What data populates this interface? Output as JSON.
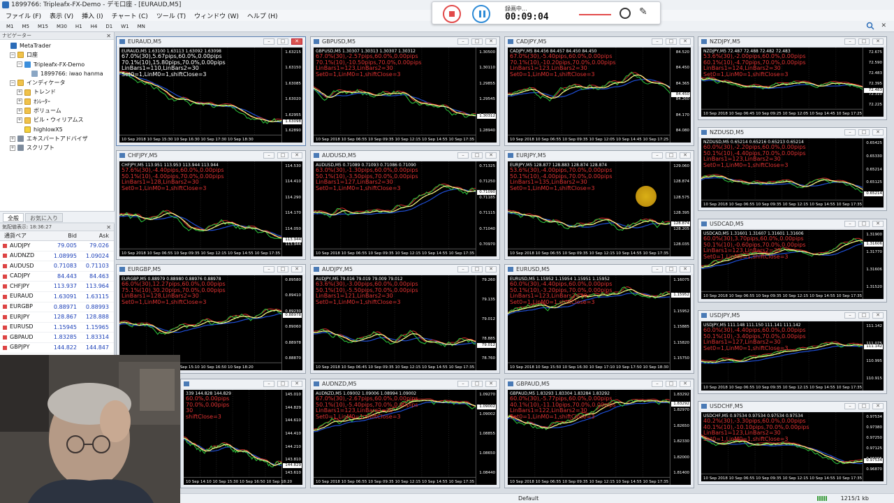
{
  "window": {
    "title": "1899766: Tripleafx-FX-Demo - デモ口座 - [EURAUD,M5]"
  },
  "menu": [
    "ファイル (F)",
    "表示 (V)",
    "挿入 (I)",
    "チャート (C)",
    "ツール (T)",
    "ウィンドウ (W)",
    "ヘルプ (H)"
  ],
  "timeframes": [
    "M1",
    "M5",
    "M15",
    "M30",
    "H1",
    "H4",
    "D1",
    "W1",
    "MN"
  ],
  "recorder": {
    "label": "録画中...",
    "time": "00:09:04"
  },
  "navigator": {
    "header": "ナビゲーター",
    "tree": [
      {
        "label": "MetaTrader",
        "indent": 0,
        "icon": "mt",
        "exp": ""
      },
      {
        "label": "口座",
        "indent": 1,
        "icon": "folder",
        "exp": "−"
      },
      {
        "label": "Tripleafx-FX-Demo",
        "indent": 2,
        "icon": "acct",
        "exp": "−"
      },
      {
        "label": "1899766: iwao hanma",
        "indent": 3,
        "icon": "user",
        "exp": ""
      },
      {
        "label": "インディケータ",
        "indent": 1,
        "icon": "folder",
        "exp": "−"
      },
      {
        "label": "トレンド",
        "indent": 2,
        "icon": "folder",
        "exp": "+"
      },
      {
        "label": "ｵｼﾚｰﾀｰ",
        "indent": 2,
        "icon": "folder",
        "exp": "+"
      },
      {
        "label": "ボリューム",
        "indent": 2,
        "icon": "folder",
        "exp": "+"
      },
      {
        "label": "ビル・ウィリアムス",
        "indent": 2,
        "icon": "folder",
        "exp": "+"
      },
      {
        "label": "highlowX5",
        "indent": 2,
        "icon": "ind",
        "exp": ""
      },
      {
        "label": "エキスパートアドバイザ",
        "indent": 1,
        "icon": "ea",
        "exp": "+"
      },
      {
        "label": "スクリプト",
        "indent": 1,
        "icon": "ea",
        "exp": "+"
      }
    ],
    "tabs": [
      "全般",
      "お気に入り"
    ]
  },
  "market_watch": {
    "header": "気配値表示: 18:36:27",
    "columns": [
      "通貨ペア",
      "Bid",
      "Ask"
    ],
    "rows": [
      {
        "symbol": "AUDJPY",
        "bid": "79.005",
        "ask": "79.026"
      },
      {
        "symbol": "AUDNZD",
        "bid": "1.08995",
        "ask": "1.09024"
      },
      {
        "symbol": "AUDUSD",
        "bid": "0.71083",
        "ask": "0.71103"
      },
      {
        "symbol": "CADJPY",
        "bid": "84.443",
        "ask": "84.463"
      },
      {
        "symbol": "CHFJPY",
        "bid": "113.937",
        "ask": "113.964"
      },
      {
        "symbol": "EURAUD",
        "bid": "1.63091",
        "ask": "1.63115"
      },
      {
        "symbol": "EURGBP",
        "bid": "0.88971",
        "ask": "0.88993"
      },
      {
        "symbol": "EURJPY",
        "bid": "128.867",
        "ask": "128.888"
      },
      {
        "symbol": "EURUSD",
        "bid": "1.15945",
        "ask": "1.15965"
      },
      {
        "symbol": "GBPAUD",
        "bid": "1.83285",
        "ask": "1.83314"
      },
      {
        "symbol": "GBPJPY",
        "bid": "144.822",
        "ask": "144.847"
      }
    ]
  },
  "charts": [
    {
      "title": "EURAUD,M5",
      "hdr": "EURAUD,M5 1.63100 1.63113 1.63092 1.63098",
      "ann": "67.0%(30),5.67pips,60.0%,0.00pips\n70.1%(10),15.80pips,70.0%,0.00pips\nLinBars1=110,LinBars2=30\nSet0=1,LinM0=1,shiftClose=3",
      "ann_color": "white",
      "xaxis": "10 Sep 2018    10 Sep 15:30    10 Sep 16:30    10 Sep 17:30    10 Sep 18:30",
      "yticks": [
        "1.63215",
        "1.63150",
        "1.63085",
        "1.63020",
        "1.62955",
        "1.62890"
      ],
      "tag": "1.63098",
      "active": true
    },
    {
      "title": "GBPUSD,M5",
      "hdr": "GBPUSD,M5 1.30307 1.30313 1.30307 1.30312",
      "ann": "67.0%(30),-2.57pips,60.0%,0.00pips\n70.1%(10),-10.50pips,70.0%,0.00pips\nLinBars1=123,LinBars2=30\nSet0=1,LinM0=1,shiftClose=3",
      "ann_color": "red",
      "xaxis": "10 Sep 2018    10 Sep 06:55    10 Sep 09:35    10 Sep 12:15    10 Sep 14:55    10 Sep 17:35",
      "yticks": [
        "1.30500",
        "1.30110",
        "1.29855",
        "1.29545",
        "1.29235",
        "1.28940"
      ],
      "tag": "1.30312",
      "active": false
    },
    {
      "title": "CADJPY,M5",
      "hdr": "CADJPY,M5 84.456 84.457 84.450 84.450",
      "ann": "67.0%(30),-5.40pips,60.0%,0.00pips\n70.1%(10),-10.20pips,70.0%,0.00pips\nLinBars1=123,LinBars2=30\nSet0=1,LinM0=1,shiftClose=3",
      "ann_color": "red",
      "xaxis": "10 Sep 2018    10 Sep 06:55    10 Sep 09:35    10 Sep 12:05    10 Sep 14:45    10 Sep 17:25",
      "yticks": [
        "84.520",
        "84.450",
        "84.365",
        "84.260",
        "84.170",
        "84.080"
      ],
      "tag": "84.450",
      "active": false
    },
    {
      "title": "NZDJPY,M5",
      "hdr": "NZDJPY,M5 72.487 72.488 72.482 72.483",
      "ann": "53.6%(30),-2.00pips,60.0%,0.00pips\n60.1%(10),-4.70pips,70.0%,0.00pips\nLinBars1=124,LinBars2=30\nSet0=1,LinM0=1,shiftClose=3",
      "ann_color": "red",
      "xaxis": "10 Sep 2018    10 Sep 06:45    10 Sep 09:25    10 Sep 12:05    10 Sep 14:45    10 Sep 17:25",
      "yticks": [
        "72.675",
        "72.590",
        "72.483",
        "72.395",
        "72.310",
        "72.225"
      ],
      "tag": "72.483",
      "active": false
    },
    {
      "title": "CHFJPY,M5",
      "hdr": "CHFJPY,M5 113.951 113.953 113.944 113.944",
      "ann": "57.6%(30),-4.40pips,60.0%,0.00pips\n50.1%(10),-4.00pips,70.0%,0.00pips\nLinBars1=128,LinBars2=30\nSet0=1,LinM0=1,shiftClose=3",
      "ann_color": "red",
      "xaxis": "10 Sep 2018    10 Sep 06:55    10 Sep 09:35    10 Sep 12:15    10 Sep 14:55    10 Sep 17:35",
      "yticks": [
        "114.530",
        "114.410",
        "114.290",
        "114.170",
        "114.050",
        "113.944"
      ],
      "tag": "113.944",
      "active": false
    },
    {
      "title": "AUDUSD,M5",
      "hdr": "AUDUSD,M5 0.71089 0.71093 0.71086 0.71090",
      "ann": "63.0%(30),-1.30pips,60.0%,0.00pips\n50.1%(10),-3.50pips,70.0%,0.00pips\nLinBars1=127,LinBars2=30\nSet0=1,LinM0=1,shiftClose=3",
      "ann_color": "red",
      "xaxis": "10 Sep 2018    10 Sep 06:55    10 Sep 09:35    10 Sep 12:15    10 Sep 14:55    10 Sep 17:35",
      "yticks": [
        "0.71325",
        "0.71250",
        "0.71185",
        "0.71115",
        "0.71040",
        "0.70970"
      ],
      "tag": "0.71090",
      "active": false
    },
    {
      "title": "EURJPY,M5",
      "hdr": "EURJPY,M5 128.877 128.883 128.874 128.874",
      "ann": "53.6%(30),-4.00pips,70.0%,0.00pips\n50.1%(10),-4.00pips,70.0%,0.00pips\nLinBars1=135,LinBars2=30\nSet0=1,LinM0=1,shiftClose=3",
      "ann_color": "red",
      "xaxis": "10 Sep 2018    10 Sep 06:55    10 Sep 09:35    10 Sep 12:15    10 Sep 14:55    10 Sep 17:35",
      "yticks": [
        "129.060",
        "128.874",
        "128.575",
        "128.395",
        "128.205",
        "128.035"
      ],
      "tag": "128.874",
      "active": false
    },
    {
      "title": "NZDUSD,M5",
      "hdr": "NZDUSD,M5 0.65214 0.65216 0.65213 0.65214",
      "ann": "60.0%(30),-2.20pips,60.0%,0.00pips\n50.1%(10),-4.40pips,70.0%,0.00pips\nLinBars1=123,LinBars2=30\nSet0=1,LinM0=1,shiftClose=3",
      "ann_color": "red",
      "xaxis": "10 Sep 2018    10 Sep 06:55    10 Sep 09:35    10 Sep 12:15    10 Sep 14:55    10 Sep 17:35",
      "yticks": [
        "0.65425",
        "0.65330",
        "0.65214",
        "0.65125",
        "0.65040"
      ],
      "tag": "0.65214",
      "active": false
    },
    {
      "title": "EURGBP,M5",
      "hdr": "EURGBP,M5 0.88979 0.88980 0.88976 0.88978",
      "ann": "66.0%(30),12.27pips,60.0%,0.00pips\n75.1%(10),30.20pips,70.0%,0.00pips\nLinBars1=128,LinBars2=30\nSet0=1,LinM0=1,shiftClose=3",
      "ann_color": "red",
      "xaxis": "10 Sep 2018    10 Sep 14:10    10 Sep 15:10    10 Sep 16:50    10 Sep 18:20",
      "yticks": [
        "0.89580",
        "0.89410",
        "0.89230",
        "0.89060",
        "0.88978",
        "0.88870"
      ],
      "tag": "0.88978",
      "active": false
    },
    {
      "title": "AUDJPY,M5",
      "hdr": "AUDJPY,M5 79.016 79.019 79.009 79.012",
      "ann": "63.6%(30),-3.00pips,60.0%,0.00pips\n50.1%(10),-5.50pips,70.0%,0.00pips\nLinBars1=121,LinBars2=30\nSet0=1,LinM0=1,shiftClose=3",
      "ann_color": "red",
      "xaxis": "10 Sep 2018    10 Sep 06:45    10 Sep 09:35    10 Sep 12:15    10 Sep 14:55    10 Sep 17:35",
      "yticks": [
        "79.260",
        "79.135",
        "79.012",
        "78.885",
        "78.760"
      ],
      "tag": "79.012",
      "active": false
    },
    {
      "title": "EURUSD,M5",
      "hdr": "EURUSD,M5 1.15952 1.15954 1.15951 1.15952",
      "ann": "60.0%(30),-4.40pips,60.0%,0.00pips\n50.1%(10),-3.20pips,70.0%,0.00pips\nLinBars1=123,LinBars2=30\nSet0=1,LinM0=1,shiftClose=3",
      "ann_color": "red",
      "xaxis": "10 Sep 2018    10 Sep 15:50    10 Sep 16:30    10 Sep 17:10    10 Sep 17:50    10 Sep 18:30",
      "yticks": [
        "1.16075",
        "1.16010",
        "1.15952",
        "1.15885",
        "1.15820",
        "1.15750"
      ],
      "tag": "1.15952",
      "active": false
    },
    {
      "title": "USDCAD,M5",
      "hdr": "USDCAD,M5 1.31601 1.31607 1.31601 1.31606",
      "ann": "60.0%(30),3.70pips,60.0%,0.00pips\n50.1%(10),-0.60pips,70.0%,0.00pips\nLinBars1=123,LinBars2=30\nSet0=1,LinM0=1,shiftClose=3",
      "ann_color": "red",
      "xaxis": "10 Sep 2018    10 Sep 06:55    10 Sep 09:35    10 Sep 12:15    10 Sep 14:55    10 Sep 17:35",
      "yticks": [
        "1.31900",
        "1.31770",
        "1.31606",
        "1.31520"
      ],
      "tag": "1.31606",
      "active": false
    },
    {
      "title": "USDJPY,M5",
      "hdr": "USDJPY,M5 111.148 111.150 111.141 111.142",
      "ann": "60.0%(30),-4.40pips,60.0%,0.00pips\n50.1%(10),-3.40pips,70.0%,0.00pips\nLinBars1=127,LinBars2=30\nSet0=1,LinM0=1,shiftClose=3",
      "ann_color": "red",
      "xaxis": "10 Sep 2018    10 Sep 06:55    10 Sep 09:35    10 Sep 12:15    10 Sep 14:55    10 Sep 17:35",
      "yticks": [
        "111.142",
        "111.075",
        "110.995",
        "110.915"
      ],
      "tag": "111.142",
      "active": false
    },
    {
      "title": "",
      "hdr": "   339 144.828 144.829",
      "ann": "60.0%,0.00pips\n70.0%,0.00pips\n30\nshiftClose=3",
      "ann_color": "red",
      "xaxis": "    10 Sep 14:10    10 Sep 15:30    10 Sep 16:50    10 Sep 18:20",
      "yticks": [
        "145.010",
        "144.829",
        "144.610",
        "144.410",
        "144.210",
        "143.810",
        "143.610"
      ],
      "tag": "144.829",
      "active": false
    },
    {
      "title": "AUDNZD,M5",
      "hdr": "AUDNZD,M5 1.09002 1.09006 1.08994 1.09002",
      "ann": "67.0%(30),-2.67pips,60.0%,0.00pips\n50.1%(10),-5.40pips,70.0%,0.00pips\nLinBars1=123,LinBars2=30\nSet0=1,LinM0=1,shiftClose=3",
      "ann_color": "red",
      "xaxis": "10 Sep 2018    10 Sep 06:55    10 Sep 09:35    10 Sep 12:15    10 Sep 14:55    10 Sep 17:35",
      "yticks": [
        "1.09270",
        "1.09002",
        "1.08855",
        "1.08650",
        "1.08440"
      ],
      "tag": "1.09002",
      "active": false
    },
    {
      "title": "GBPAUD,M5",
      "hdr": "GBPAUD,M5 1.83293 1.83304 1.83284 1.83292",
      "ann": "60.0%(30),-5.77pips,60.0%,0.00pips\n40.1%(10),-11.10pips,70.0%,0.00pips\nLinBars1=122,LinBars2=30\nSet0=1,LinM0=1,shiftClose=3",
      "ann_color": "red",
      "xaxis": "10 Sep 2018    10 Sep 06:55    10 Sep 09:35    10 Sep 12:15    10 Sep 14:55    10 Sep 17:35",
      "yticks": [
        "1.83292",
        "1.82970",
        "1.82650",
        "1.82330",
        "1.82000",
        "1.81400"
      ],
      "tag": "1.83292",
      "active": false
    },
    {
      "title": "USDCHF,M5",
      "hdr": "USDCHF,M5 0.97534 0.97534 0.97534 0.97534",
      "ann": "40.2%(30),-3.30pips,60.0%,0.00pips\n40.1%(10),-10.10pips,70.0%,0.00pips\nLinBars1=123,LinBars2=30\nSet0=1,LinM0=1,shiftClose=3",
      "ann_color": "red",
      "xaxis": "10 Sep 2018    10 Sep 06:55    10 Sep 09:35    10 Sep 12:15    10 Sep 14:55    10 Sep 17:35",
      "yticks": [
        "0.97534",
        "0.97380",
        "0.97250",
        "0.97125",
        "0.96995",
        "0.96870"
      ],
      "tag": "0.97534",
      "active": false
    }
  ],
  "status": {
    "profile": "Default",
    "traffic": "1215/1 kb"
  }
}
